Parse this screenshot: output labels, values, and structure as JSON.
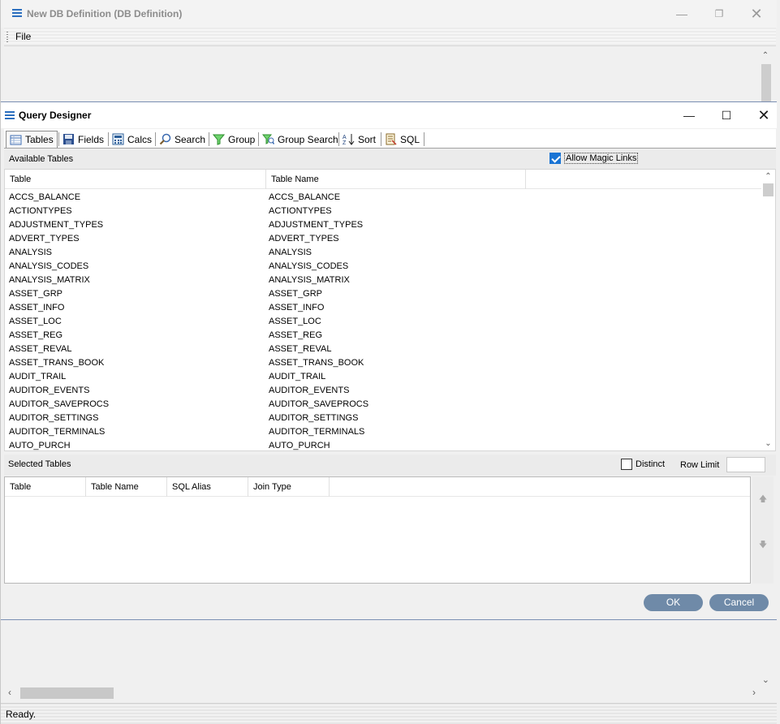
{
  "outer_window": {
    "title": "New DB Definition (DB Definition)",
    "menu": {
      "file": "File"
    },
    "status": "Ready."
  },
  "query_designer": {
    "title": "Query Designer",
    "tabs": [
      {
        "label": "Tables",
        "icon": "table-icon"
      },
      {
        "label": "Fields",
        "icon": "save-fields-icon"
      },
      {
        "label": "Calcs",
        "icon": "calculator-icon"
      },
      {
        "label": "Search",
        "icon": "search-icon"
      },
      {
        "label": "Group",
        "icon": "funnel-icon"
      },
      {
        "label": "Group Search",
        "icon": "funnel-search-icon"
      },
      {
        "label": "Sort",
        "icon": "sort-az-icon"
      },
      {
        "label": "SQL",
        "icon": "sql-script-icon"
      }
    ],
    "available": {
      "label": "Available Tables",
      "allow_magic_links": "Allow Magic Links",
      "allow_magic_links_checked": true,
      "columns": [
        "Table",
        "Table Name"
      ],
      "rows": [
        [
          "ACCS_BALANCE",
          "ACCS_BALANCE"
        ],
        [
          "ACTIONTYPES",
          "ACTIONTYPES"
        ],
        [
          "ADJUSTMENT_TYPES",
          "ADJUSTMENT_TYPES"
        ],
        [
          "ADVERT_TYPES",
          "ADVERT_TYPES"
        ],
        [
          "ANALYSIS",
          "ANALYSIS"
        ],
        [
          "ANALYSIS_CODES",
          "ANALYSIS_CODES"
        ],
        [
          "ANALYSIS_MATRIX",
          "ANALYSIS_MATRIX"
        ],
        [
          "ASSET_GRP",
          "ASSET_GRP"
        ],
        [
          "ASSET_INFO",
          "ASSET_INFO"
        ],
        [
          "ASSET_LOC",
          "ASSET_LOC"
        ],
        [
          "ASSET_REG",
          "ASSET_REG"
        ],
        [
          "ASSET_REVAL",
          "ASSET_REVAL"
        ],
        [
          "ASSET_TRANS_BOOK",
          "ASSET_TRANS_BOOK"
        ],
        [
          "AUDIT_TRAIL",
          "AUDIT_TRAIL"
        ],
        [
          "AUDITOR_EVENTS",
          "AUDITOR_EVENTS"
        ],
        [
          "AUDITOR_SAVEPROCS",
          "AUDITOR_SAVEPROCS"
        ],
        [
          "AUDITOR_SETTINGS",
          "AUDITOR_SETTINGS"
        ],
        [
          "AUDITOR_TERMINALS",
          "AUDITOR_TERMINALS"
        ],
        [
          "AUTO_PURCH",
          "AUTO_PURCH"
        ]
      ]
    },
    "selected": {
      "label": "Selected Tables",
      "distinct": "Distinct",
      "distinct_checked": false,
      "row_limit": "Row Limit",
      "row_limit_value": "",
      "columns": [
        "Table",
        "Table Name",
        "SQL Alias",
        "Join Type"
      ]
    },
    "buttons": {
      "ok": "OK",
      "cancel": "Cancel"
    }
  }
}
